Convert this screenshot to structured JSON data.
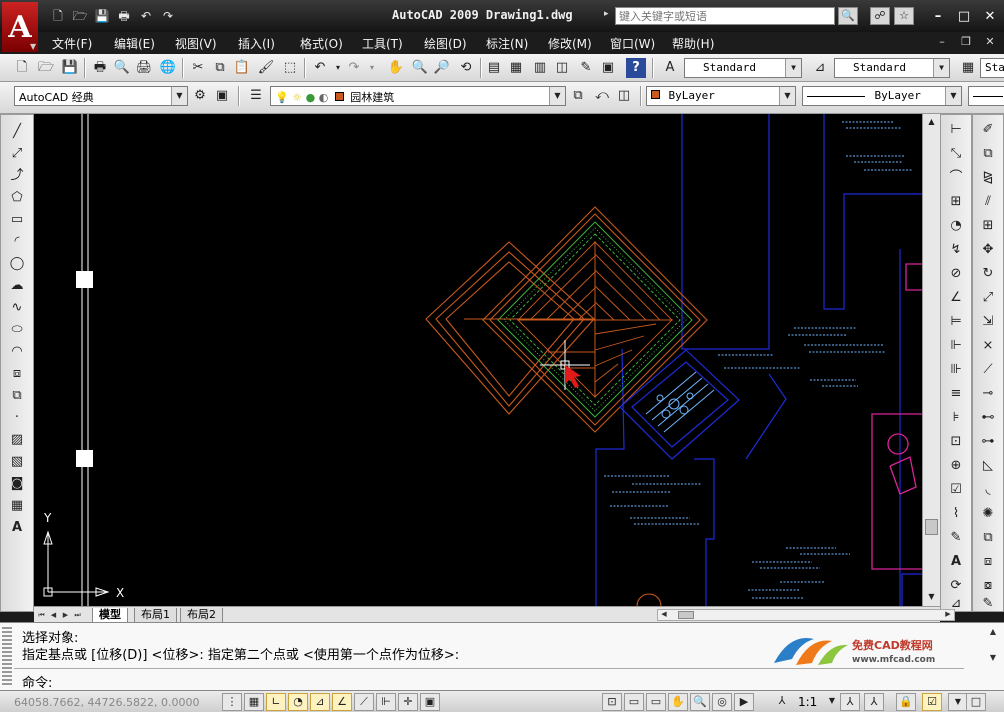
{
  "window": {
    "title": "AutoCAD 2009 Drawing1.dwg",
    "search_placeholder": "键入关键字或短语"
  },
  "menu": [
    "文件(F)",
    "编辑(E)",
    "视图(V)",
    "插入(I)",
    "格式(O)",
    "工具(T)",
    "绘图(D)",
    "标注(N)",
    "修改(M)",
    "窗口(W)",
    "帮助(H)"
  ],
  "toolbar1": {
    "text_style": "Standard",
    "dim_style": "Standard",
    "table_style": "Standard"
  },
  "toolbar2": {
    "workspace": "AutoCAD 经典",
    "layer": "园林建筑",
    "color": "ByLayer",
    "linetype": "ByLayer",
    "layer_color": "#c85a1e"
  },
  "ucs": {
    "x_label": "X",
    "y_label": "Y"
  },
  "layout_tabs": [
    "模型",
    "布局1",
    "布局2"
  ],
  "command": {
    "line1": "选择对象:",
    "line2": "指定基点或 [位移(D)] <位移>:  指定第二个点或 <使用第一个点作为位移>:",
    "prompt": "命令:"
  },
  "watermark": {
    "name": "免费CAD教程网",
    "url": "www.mfcad.com"
  },
  "status": {
    "coords": "64058.7662, 44726.5822, 0.0000",
    "annotation_scale": "1:1"
  },
  "colors": {
    "orange": "#c85a1e",
    "blue": "#1e2bd8",
    "magenta": "#d8239a",
    "cyan": "#6fb7ff",
    "green": "#3fae3f",
    "crosshair": "#ffffff",
    "cursor": "#e21a1a"
  }
}
